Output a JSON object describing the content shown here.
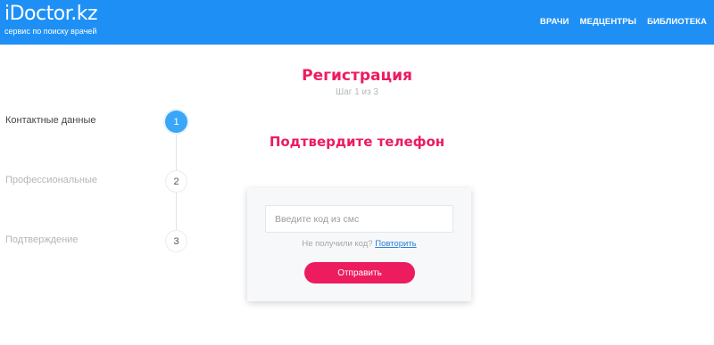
{
  "header": {
    "logo_name": "iDoctor.kz",
    "logo_tagline": "сервис по поиску врачей",
    "nav": [
      "ВРАЧИ",
      "МЕДЦЕНТРЫ",
      "БИБЛИОТЕКА"
    ],
    "background_color": "#1e90f5"
  },
  "registration": {
    "title": "Регистрация",
    "step_info": "Шаг 1 из 3",
    "accent_color": "#ec1c5f"
  },
  "steps": [
    {
      "label": "Контактные данные",
      "number": "1",
      "state": "active"
    },
    {
      "label": "Профессиональные",
      "number": "2",
      "state": "inactive"
    },
    {
      "label": "Подтверждение",
      "number": "3",
      "state": "inactive"
    }
  ],
  "confirm": {
    "title": "Подтвердите телефон",
    "input_value": "",
    "input_placeholder": "Введите код из смс",
    "resend_text": "Не получили код?",
    "resend_link": "Повторить",
    "submit_label": "Отправить"
  }
}
